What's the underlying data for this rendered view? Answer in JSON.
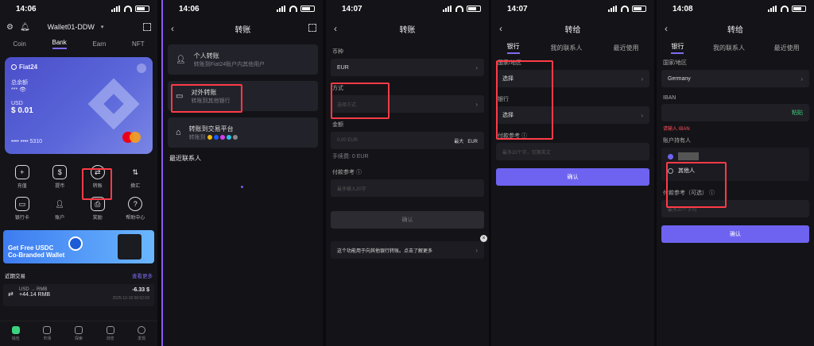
{
  "status": {
    "times": [
      "14:06",
      "14:06",
      "14:07",
      "14:07",
      "14:08"
    ]
  },
  "p1": {
    "wallet_name": "Wallet01-DDW",
    "tabs": [
      "Coin",
      "Bank",
      "Earn",
      "NFT"
    ],
    "brand": "Fiat24",
    "balance_label": "总余额",
    "currency": "USD",
    "amount": "$ 0.01",
    "card_last": "•••• •••• 5310",
    "actions": [
      "充值",
      "提币",
      "转账",
      "换汇",
      "银行卡",
      "账户",
      "奖励",
      "帮助中心"
    ],
    "promo_line1": "Get Free USDC",
    "promo_line2": "Co-Branded Wallet",
    "recent_title": "近期交易",
    "recent_more": "查看更多",
    "tx_pair": "USD → RMB",
    "tx_amount1": "-6.33 $",
    "tx_amount2": "+44.14 RMB",
    "tx_time": "2025-12-18 08:52:09",
    "bottom": [
      "钱包",
      "市场",
      "探索",
      "浏览",
      "发现"
    ],
    "colors": {
      "accent": "#7c6cf0",
      "card": "#5a66d9",
      "highlight": "#ff3b47"
    }
  },
  "p2": {
    "title": "转账",
    "personal_title": "个人转账",
    "personal_sub": "转账到Fiat24账户内其他用户",
    "external_title": "对外转账",
    "external_sub": "转账到其他银行",
    "exchange_title": "转账到交易平台",
    "exchange_sub": "转账到",
    "recent": "最近联系人"
  },
  "p3": {
    "title": "转账",
    "currency_label": "币种",
    "currency_value": "EUR",
    "method_label": "方式",
    "method_placeholder": "选择方式",
    "amount_label": "金额",
    "amount_placeholder": "0.00 EUR",
    "amount_max": "最大",
    "amount_ccy": "EUR",
    "fee_text": "手续费: 0 EUR",
    "ref_label": "付款参考",
    "ref_placeholder": "最多输入20字",
    "confirm": "确认",
    "tip": "这个功能用于向其他银行转账。点击了解更多"
  },
  "p4": {
    "title": "转给",
    "tabs": [
      "银行",
      "我的联系人",
      "最近使用"
    ],
    "country_label": "国家/地区",
    "country_value": "选择",
    "bank_label": "银行",
    "bank_value": "选择",
    "ref_label": "付款参考",
    "ref_placeholder": "最多20个字，仅限英文",
    "confirm": "确认"
  },
  "p5": {
    "title": "转给",
    "tabs": [
      "银行",
      "我的联系人",
      "最近使用"
    ],
    "country_label": "国家/地区",
    "country_value": "Germany",
    "iban_label": "IBAN",
    "iban_paste": "粘贴",
    "iban_error": "请输入 IBAN",
    "holder_label": "账户持有人",
    "holder_self": "本人",
    "holder_other": "其他人",
    "ref_label": "付款参考（可选）",
    "ref_placeholder": "最多20个字符",
    "confirm": "确认"
  }
}
